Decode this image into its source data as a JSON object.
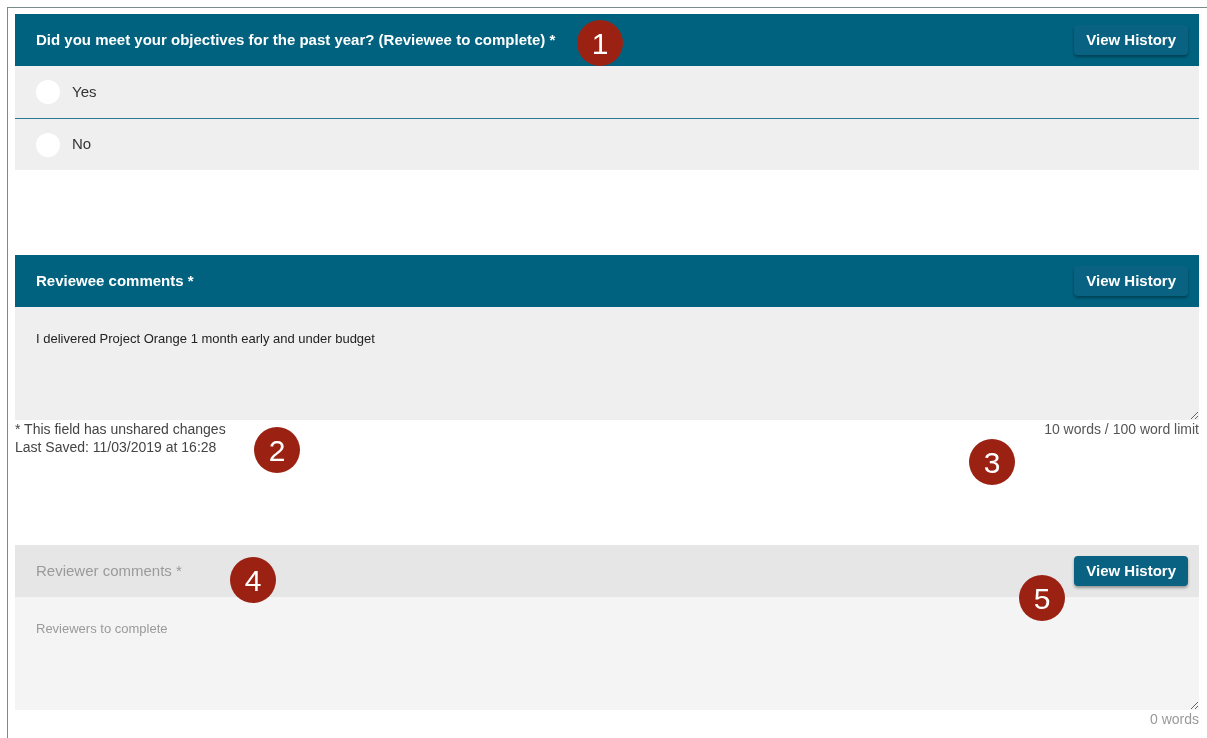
{
  "sections": [
    {
      "kind": "radio",
      "title": "Did you meet your objectives for the past year? (Reviewee to complete) *",
      "disabled": false,
      "button": "View History",
      "options": [
        {
          "label": "Yes",
          "selected": false
        },
        {
          "label": "No",
          "selected": false
        }
      ]
    },
    {
      "kind": "textarea",
      "title": "Reviewee comments *",
      "disabled": false,
      "button": "View History",
      "value": "I delivered Project Orange 1 month early and under budget",
      "notes": [
        "* This field has unshared changes",
        "Last Saved: 11/03/2019 at 16:28"
      ],
      "word_count": "10 words / 100 word limit"
    },
    {
      "kind": "textarea",
      "title": "Reviewer comments *",
      "disabled": true,
      "button": "View History",
      "placeholder": "Reviewers to complete",
      "word_count": "0 words"
    }
  ],
  "callouts": [
    {
      "label": "1"
    },
    {
      "label": "2"
    },
    {
      "label": "3"
    },
    {
      "label": "4"
    },
    {
      "label": "5"
    }
  ]
}
